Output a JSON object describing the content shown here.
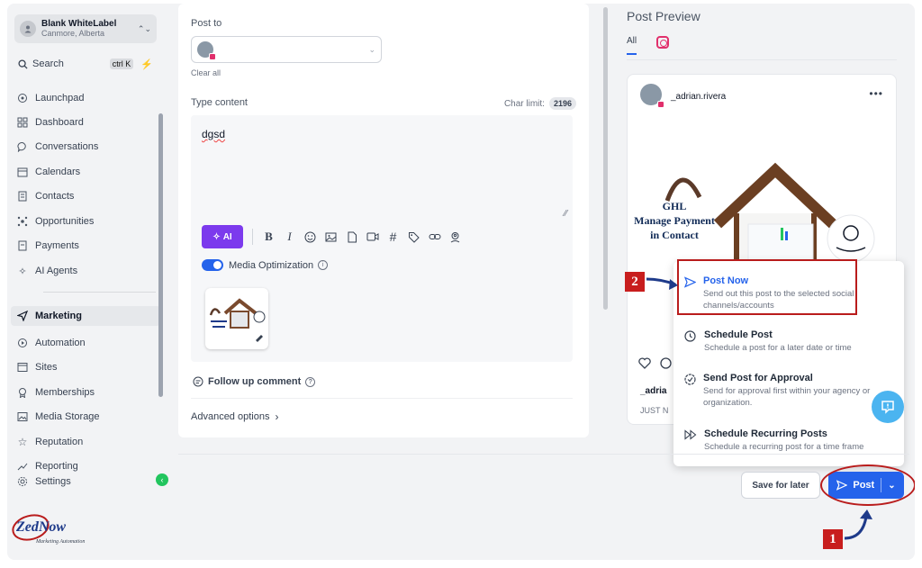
{
  "account": {
    "name": "Blank WhiteLabel",
    "location": "Canmore, Alberta"
  },
  "search": {
    "label": "Search",
    "shortcut": "ctrl K"
  },
  "sidebar": {
    "items": [
      {
        "label": "Launchpad",
        "icon": "rocket-icon"
      },
      {
        "label": "Dashboard",
        "icon": "grid-icon"
      },
      {
        "label": "Conversations",
        "icon": "chat-icon"
      },
      {
        "label": "Calendars",
        "icon": "calendar-icon"
      },
      {
        "label": "Contacts",
        "icon": "contacts-icon"
      },
      {
        "label": "Opportunities",
        "icon": "opportunities-icon"
      },
      {
        "label": "Payments",
        "icon": "payments-icon"
      },
      {
        "label": "AI Agents",
        "icon": "sparkle-icon"
      },
      {
        "label": "Marketing",
        "icon": "send-icon",
        "active": true
      },
      {
        "label": "Automation",
        "icon": "automation-icon"
      },
      {
        "label": "Sites",
        "icon": "sites-icon"
      },
      {
        "label": "Memberships",
        "icon": "memberships-icon"
      },
      {
        "label": "Media Storage",
        "icon": "image-icon"
      },
      {
        "label": "Reputation",
        "icon": "star-icon"
      },
      {
        "label": "Reporting",
        "icon": "trend-icon"
      },
      {
        "label": "Settings",
        "icon": "gear-icon"
      }
    ]
  },
  "brand": {
    "logo_text": "ZedNow",
    "tagline": "Marketing Automation"
  },
  "editor": {
    "post_to_label": "Post to",
    "clear_all": "Clear all",
    "type_content_label": "Type content",
    "char_limit_label": "Char limit:",
    "char_limit_value": "2196",
    "content_text": "dgsd",
    "ai_label": "AI",
    "media_optimization_label": "Media Optimization",
    "follow_up_label": "Follow up comment",
    "advanced_label": "Advanced options"
  },
  "preview": {
    "title": "Post Preview",
    "tab_all": "All",
    "username": "_adrian.rivera",
    "image_text_lines": [
      "GHL",
      "Manage Payment",
      "in Contact"
    ],
    "caption_name": "_adria",
    "time_text": "JUST N"
  },
  "dropdown": {
    "items": [
      {
        "title": "Post Now",
        "desc": "Send out this post to the selected social channels/accounts"
      },
      {
        "title": "Schedule Post",
        "desc": "Schedule a post for a later date or time"
      },
      {
        "title": "Send Post for Approval",
        "desc": "Send for approval first within your agency or organization."
      },
      {
        "title": "Schedule Recurring Posts",
        "desc": "Schedule a recurring post for a time frame"
      }
    ]
  },
  "footer": {
    "save_later": "Save for later",
    "post": "Post"
  },
  "annotations": {
    "step1": "1",
    "step2": "2"
  },
  "colors": {
    "primary": "#2563eb",
    "ai": "#7c3aed",
    "highlight": "#b91c1c",
    "instagram": "#e1306c"
  }
}
